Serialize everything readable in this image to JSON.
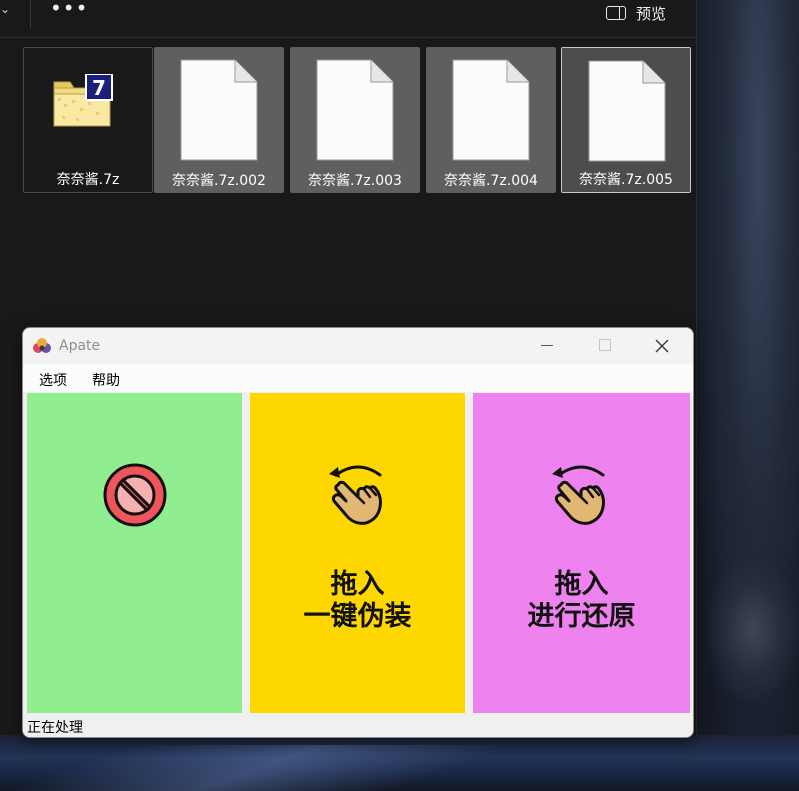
{
  "explorer": {
    "toolbar": {
      "more_label": "•••",
      "preview_label": "预览"
    },
    "files": [
      {
        "name": "奈奈酱.7z",
        "icon": "7z-archive-icon"
      },
      {
        "name": "奈奈酱.7z.002",
        "icon": "blank-document-icon"
      },
      {
        "name": "奈奈酱.7z.003",
        "icon": "blank-document-icon"
      },
      {
        "name": "奈奈酱.7z.004",
        "icon": "blank-document-icon"
      },
      {
        "name": "奈奈酱.7z.005",
        "icon": "blank-document-icon"
      }
    ]
  },
  "apate": {
    "title": "Apate",
    "menu": {
      "options": "选项",
      "help": "帮助"
    },
    "panels": {
      "green": {
        "icon": "prohibited-icon",
        "color": "#90ee90"
      },
      "yellow": {
        "icon": "drag-hand-icon",
        "line1": "拖入",
        "line2": "一键伪装",
        "color": "#ffd700"
      },
      "pink": {
        "icon": "drag-hand-icon",
        "line1": "拖入",
        "line2": "进行还原",
        "color": "#ee82ee"
      }
    },
    "status": "正在处理"
  }
}
